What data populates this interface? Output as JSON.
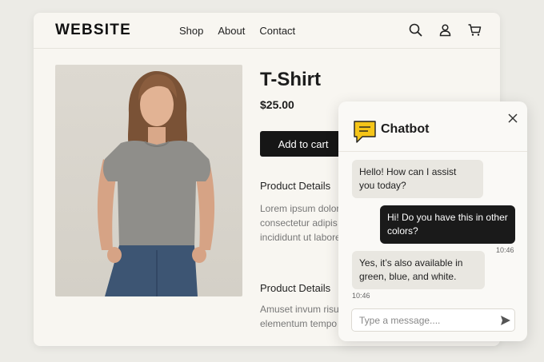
{
  "header": {
    "logo": "WEBSITE",
    "nav": [
      "Shop",
      "About",
      "Contact"
    ],
    "icons": [
      "search-icon",
      "user-icon",
      "cart-icon"
    ]
  },
  "product": {
    "title": "T-Shirt",
    "price": "$25.00",
    "add_to_cart": "Add to cart",
    "image": "woman-in-gray-tshirt",
    "sections": [
      {
        "heading": "Product Details",
        "lines": [
          "Lorem ipsum dolor",
          "consectetur adipis",
          "incididunt ut labore"
        ]
      },
      {
        "heading": "Product Details",
        "lines": [
          "Amuset invum risu",
          "elementum tempo"
        ]
      }
    ]
  },
  "chat": {
    "title": "Chatbot",
    "icon": "chat-bubble-icon",
    "messages": [
      {
        "from": "bot",
        "lines": [
          "Hello! How can I assist",
          "you today?"
        ],
        "time": ""
      },
      {
        "from": "user",
        "lines": [
          "Hi! Do you have this in other",
          "colors?"
        ],
        "time": "10:46"
      },
      {
        "from": "bot",
        "lines": [
          "Yes, it’s also available in",
          "green, blue, and white."
        ],
        "time": "10:46"
      }
    ],
    "input_placeholder": "Type a message....",
    "accent_color": "#f5c518"
  }
}
